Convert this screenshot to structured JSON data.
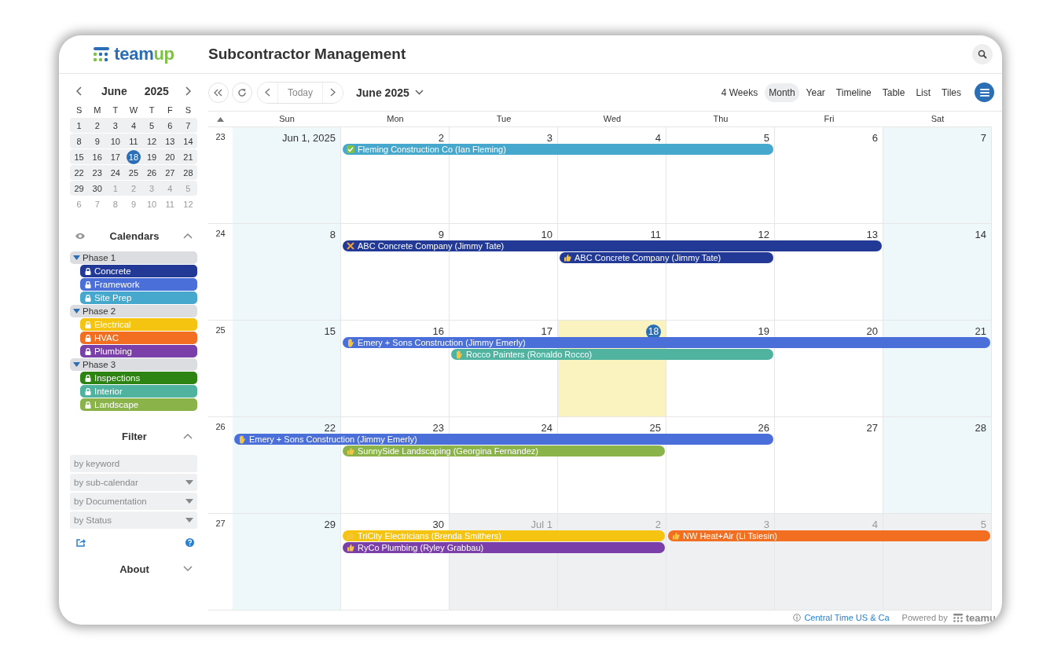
{
  "logo": {
    "text_start": "team",
    "text_end": "up"
  },
  "title": "Subcontractor Management",
  "mini_calendar": {
    "month": "June",
    "year": "2025",
    "weekdays": [
      "S",
      "M",
      "T",
      "W",
      "T",
      "F",
      "S"
    ],
    "weeks": [
      [
        {
          "label": "1",
          "muted": false,
          "selected": false
        },
        {
          "label": "2",
          "muted": false,
          "selected": false
        },
        {
          "label": "3",
          "muted": false,
          "selected": false
        },
        {
          "label": "4",
          "muted": false,
          "selected": false
        },
        {
          "label": "5",
          "muted": false,
          "selected": false
        },
        {
          "label": "6",
          "muted": false,
          "selected": false
        },
        {
          "label": "7",
          "muted": false,
          "selected": false
        }
      ],
      [
        {
          "label": "8",
          "muted": false,
          "selected": false
        },
        {
          "label": "9",
          "muted": false,
          "selected": false
        },
        {
          "label": "10",
          "muted": false,
          "selected": false
        },
        {
          "label": "11",
          "muted": false,
          "selected": false
        },
        {
          "label": "12",
          "muted": false,
          "selected": false
        },
        {
          "label": "13",
          "muted": false,
          "selected": false
        },
        {
          "label": "14",
          "muted": false,
          "selected": false
        }
      ],
      [
        {
          "label": "15",
          "muted": false,
          "selected": false
        },
        {
          "label": "16",
          "muted": false,
          "selected": false
        },
        {
          "label": "17",
          "muted": false,
          "selected": false
        },
        {
          "label": "18",
          "muted": false,
          "selected": true
        },
        {
          "label": "19",
          "muted": false,
          "selected": false
        },
        {
          "label": "20",
          "muted": false,
          "selected": false
        },
        {
          "label": "21",
          "muted": false,
          "selected": false
        }
      ],
      [
        {
          "label": "22",
          "muted": false,
          "selected": false
        },
        {
          "label": "23",
          "muted": false,
          "selected": false
        },
        {
          "label": "24",
          "muted": false,
          "selected": false
        },
        {
          "label": "25",
          "muted": false,
          "selected": false
        },
        {
          "label": "26",
          "muted": false,
          "selected": false
        },
        {
          "label": "27",
          "muted": false,
          "selected": false
        },
        {
          "label": "28",
          "muted": false,
          "selected": false
        }
      ],
      [
        {
          "label": "29",
          "muted": false,
          "selected": false
        },
        {
          "label": "30",
          "muted": false,
          "selected": false
        },
        {
          "label": "1",
          "muted": true,
          "selected": false
        },
        {
          "label": "2",
          "muted": true,
          "selected": false
        },
        {
          "label": "3",
          "muted": true,
          "selected": false
        },
        {
          "label": "4",
          "muted": true,
          "selected": false
        },
        {
          "label": "5",
          "muted": true,
          "selected": false
        }
      ],
      [
        {
          "label": "6",
          "muted": true,
          "selected": false
        },
        {
          "label": "7",
          "muted": true,
          "selected": false
        },
        {
          "label": "8",
          "muted": true,
          "selected": false
        },
        {
          "label": "9",
          "muted": true,
          "selected": false
        },
        {
          "label": "10",
          "muted": true,
          "selected": false
        },
        {
          "label": "11",
          "muted": true,
          "selected": false
        },
        {
          "label": "12",
          "muted": true,
          "selected": false
        }
      ]
    ]
  },
  "calendars": {
    "title": "Calendars",
    "expanded": true,
    "groups": [
      {
        "label": "Phase 1",
        "expanded": true,
        "items": [
          {
            "label": "Concrete",
            "color": "#223a96"
          },
          {
            "label": "Framework",
            "color": "#4a6fd8"
          },
          {
            "label": "Site Prep",
            "color": "#46a8cc"
          }
        ]
      },
      {
        "label": "Phase 2",
        "expanded": true,
        "items": [
          {
            "label": "Electrical",
            "color": "#f5c410"
          },
          {
            "label": "HVAC",
            "color": "#f26f21"
          },
          {
            "label": "Plumbing",
            "color": "#7a3fa8"
          }
        ]
      },
      {
        "label": "Phase 3",
        "expanded": true,
        "items": [
          {
            "label": "Inspections",
            "color": "#2e8412"
          },
          {
            "label": "Interior",
            "color": "#4fb3a0"
          },
          {
            "label": "Landscape",
            "color": "#8ab34a"
          }
        ]
      }
    ]
  },
  "filter": {
    "title": "Filter",
    "expanded": true,
    "fields": [
      {
        "kind": "text",
        "placeholder": "by keyword"
      },
      {
        "kind": "dropdown",
        "placeholder": "by sub-calendar"
      },
      {
        "kind": "dropdown",
        "placeholder": "by Documentation"
      },
      {
        "kind": "dropdown",
        "placeholder": "by Status"
      }
    ]
  },
  "about": {
    "title": "About",
    "expanded": false
  },
  "toolbar": {
    "today": "Today",
    "period": "June 2025",
    "views": [
      {
        "label": "4 Weeks",
        "selected": false
      },
      {
        "label": "Month",
        "selected": true
      },
      {
        "label": "Year",
        "selected": false
      },
      {
        "label": "Timeline",
        "selected": false
      },
      {
        "label": "Table",
        "selected": false
      },
      {
        "label": "List",
        "selected": false
      },
      {
        "label": "Tiles",
        "selected": false
      }
    ]
  },
  "weekdays": [
    "Sun",
    "Mon",
    "Tue",
    "Wed",
    "Thu",
    "Fri",
    "Sat"
  ],
  "weeks": [
    {
      "number": "23",
      "days": [
        {
          "label": "Jun 1, 2025",
          "today": false,
          "other_month": false
        },
        {
          "label": "2",
          "today": false,
          "other_month": false
        },
        {
          "label": "3",
          "today": false,
          "other_month": false
        },
        {
          "label": "4",
          "today": false,
          "other_month": false
        },
        {
          "label": "5",
          "today": false,
          "other_month": false
        },
        {
          "label": "6",
          "today": false,
          "other_month": false
        },
        {
          "label": "7",
          "today": false,
          "other_month": false
        }
      ],
      "lanes": [
        [
          {
            "kind": "empty"
          },
          {
            "kind": "event",
            "event": {
              "label": "Fleming Construction Co (Ian Fleming)",
              "kind": "check",
              "color": "#46a8cc"
            }
          },
          {
            "kind": "continue"
          },
          {
            "kind": "continue"
          },
          {
            "kind": "continue"
          },
          {
            "kind": "empty"
          },
          {
            "kind": "empty"
          }
        ]
      ]
    },
    {
      "number": "24",
      "days": [
        {
          "label": "8",
          "today": false,
          "other_month": false
        },
        {
          "label": "9",
          "today": false,
          "other_month": false
        },
        {
          "label": "10",
          "today": false,
          "other_month": false
        },
        {
          "label": "11",
          "today": false,
          "other_month": false
        },
        {
          "label": "12",
          "today": false,
          "other_month": false
        },
        {
          "label": "13",
          "today": false,
          "other_month": false
        },
        {
          "label": "14",
          "today": false,
          "other_month": false
        }
      ],
      "lanes": [
        [
          {
            "kind": "empty"
          },
          {
            "kind": "event",
            "event": {
              "label": "ABC Concrete Company (Jimmy Tate)",
              "kind": "tools",
              "color": "#223a96"
            }
          },
          {
            "kind": "continue"
          },
          {
            "kind": "continue"
          },
          {
            "kind": "continue"
          },
          {
            "kind": "continue"
          },
          {
            "kind": "empty"
          }
        ],
        [
          {
            "kind": "empty"
          },
          {
            "kind": "empty"
          },
          {
            "kind": "empty"
          },
          {
            "kind": "event",
            "event": {
              "label": "ABC Concrete Company (Jimmy Tate)",
              "kind": "thumbs_up",
              "color": "#223a96"
            }
          },
          {
            "kind": "continue"
          },
          {
            "kind": "empty"
          },
          {
            "kind": "empty"
          }
        ]
      ]
    },
    {
      "number": "25",
      "days": [
        {
          "label": "15",
          "today": false,
          "other_month": false
        },
        {
          "label": "16",
          "today": false,
          "other_month": false
        },
        {
          "label": "17",
          "today": false,
          "other_month": false
        },
        {
          "label": "18",
          "today": true,
          "other_month": false
        },
        {
          "label": "19",
          "today": false,
          "other_month": false
        },
        {
          "label": "20",
          "today": false,
          "other_month": false
        },
        {
          "label": "21",
          "today": false,
          "other_month": false
        }
      ],
      "lanes": [
        [
          {
            "kind": "empty"
          },
          {
            "kind": "event",
            "event": {
              "label": "Emery + Sons Construction (Jimmy Emerly)",
              "kind": "hand",
              "color": "#4a6fd8"
            }
          },
          {
            "kind": "continue"
          },
          {
            "kind": "continue"
          },
          {
            "kind": "continue"
          },
          {
            "kind": "continue"
          },
          {
            "kind": "continue"
          }
        ],
        [
          {
            "kind": "empty"
          },
          {
            "kind": "empty"
          },
          {
            "kind": "event",
            "event": {
              "label": "Rocco Painters (Ronaldo Rocco)",
              "kind": "hand",
              "color": "#4fb3a0"
            }
          },
          {
            "kind": "continue"
          },
          {
            "kind": "continue"
          },
          {
            "kind": "empty"
          },
          {
            "kind": "empty"
          }
        ]
      ]
    },
    {
      "number": "26",
      "days": [
        {
          "label": "22",
          "today": false,
          "other_month": false
        },
        {
          "label": "23",
          "today": false,
          "other_month": false
        },
        {
          "label": "24",
          "today": false,
          "other_month": false
        },
        {
          "label": "25",
          "today": false,
          "other_month": false
        },
        {
          "label": "26",
          "today": false,
          "other_month": false
        },
        {
          "label": "27",
          "today": false,
          "other_month": false
        },
        {
          "label": "28",
          "today": false,
          "other_month": false
        }
      ],
      "lanes": [
        [
          {
            "kind": "event",
            "event": {
              "label": "Emery + Sons Construction (Jimmy Emerly)",
              "kind": "hand",
              "color": "#4a6fd8"
            }
          },
          {
            "kind": "continue"
          },
          {
            "kind": "continue"
          },
          {
            "kind": "continue"
          },
          {
            "kind": "continue"
          },
          {
            "kind": "empty"
          },
          {
            "kind": "empty"
          }
        ],
        [
          {
            "kind": "empty"
          },
          {
            "kind": "event",
            "event": {
              "label": "SunnySide Landscaping (Georgina Fernandez)",
              "kind": "thumbs_up",
              "color": "#8ab34a"
            }
          },
          {
            "kind": "continue"
          },
          {
            "kind": "continue"
          },
          {
            "kind": "empty"
          },
          {
            "kind": "empty"
          },
          {
            "kind": "empty"
          }
        ]
      ]
    },
    {
      "number": "27",
      "days": [
        {
          "label": "29",
          "today": false,
          "other_month": false
        },
        {
          "label": "30",
          "today": false,
          "other_month": false
        },
        {
          "label": "Jul 1",
          "today": false,
          "other_month": true
        },
        {
          "label": "2",
          "today": false,
          "other_month": true
        },
        {
          "label": "3",
          "today": false,
          "other_month": true
        },
        {
          "label": "4",
          "today": false,
          "other_month": true
        },
        {
          "label": "5",
          "today": false,
          "other_month": true
        }
      ],
      "lanes": [
        [
          {
            "kind": "empty"
          },
          {
            "kind": "event",
            "event": {
              "label": "TriCity Electricians (Brenda Smithers)",
              "kind": "thumbs_up",
              "color": "#f5c410"
            }
          },
          {
            "kind": "continue"
          },
          {
            "kind": "continue"
          },
          {
            "kind": "event",
            "event": {
              "label": "NW Heat+Air (Li Tsiesin)",
              "kind": "thumbs_up",
              "color": "#f26f21"
            }
          },
          {
            "kind": "continue"
          },
          {
            "kind": "continue"
          }
        ],
        [
          {
            "kind": "empty"
          },
          {
            "kind": "event",
            "event": {
              "label": "RyCo Plumbing (Ryley Grabbau)",
              "kind": "thumbs_up",
              "color": "#7a3fa8"
            }
          },
          {
            "kind": "continue"
          },
          {
            "kind": "continue"
          },
          {
            "kind": "empty"
          },
          {
            "kind": "empty"
          },
          {
            "kind": "empty"
          }
        ]
      ]
    }
  ],
  "footer": {
    "timezone": "Central Time US & Ca",
    "powered_by": "Powered by",
    "brand": "teamu"
  }
}
